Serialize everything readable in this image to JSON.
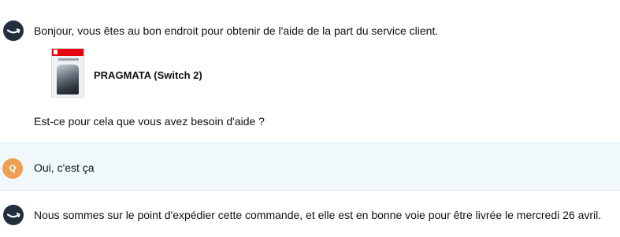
{
  "messages": [
    {
      "author": "bot",
      "avatar_icon": "amazon-smile-icon",
      "text": "Bonjour, vous êtes au bon endroit pour obtenir de l'aide de la part du service client.",
      "product": {
        "thumbnail_icon": "game-box-art-icon",
        "title": "PRAGMATA (Switch 2)"
      },
      "follow_up": "Est-ce pour cela que vous avez besoin d'aide ?"
    },
    {
      "author": "user",
      "avatar_letter": "Q",
      "text": "Oui, c'est ça"
    },
    {
      "author": "bot",
      "avatar_icon": "amazon-smile-icon",
      "text": "Nous sommes sur le point d'expédier cette commande, et elle est en bonne voie pour être livrée le mercredi 26 avril."
    }
  ],
  "colors": {
    "bot_avatar": "#232f3e",
    "smile": "#ffffff",
    "user_avatar": "#ef9f53",
    "user_row_bg": "#f0f8fb",
    "box_art_red": "#e4000f"
  }
}
